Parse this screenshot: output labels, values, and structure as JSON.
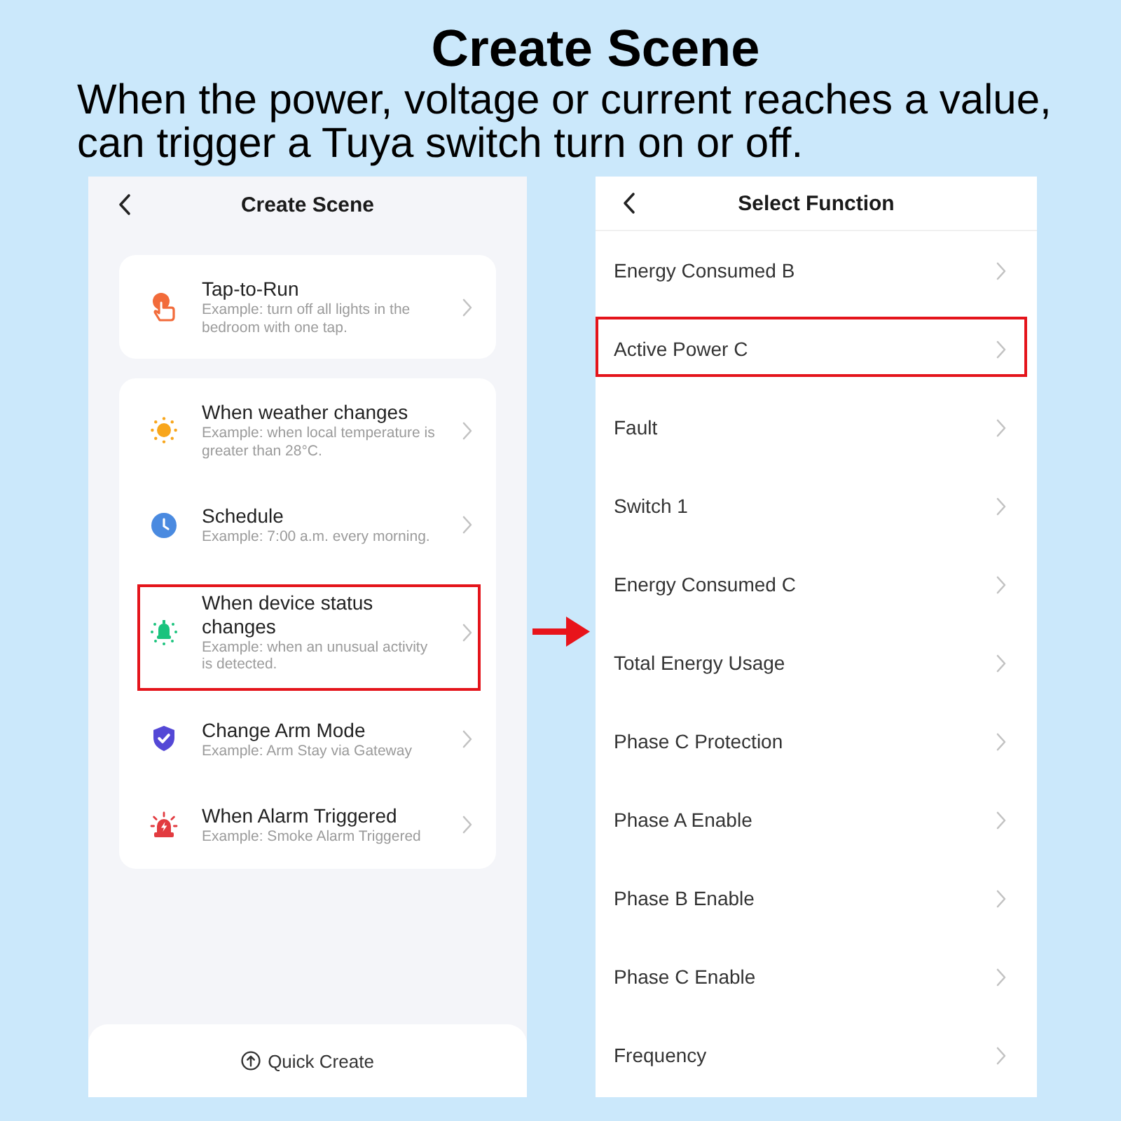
{
  "header": {
    "title": "Create Scene",
    "description": "When the power, voltage or current reaches a value, can trigger a Tuya switch turn on or off."
  },
  "scene_screen": {
    "title": "Create Scene",
    "groups": [
      {
        "items": [
          {
            "kind": "tap",
            "title": "Tap-to-Run",
            "example": "Example: turn off all lights in the bedroom with one tap.",
            "highlighted": false
          }
        ]
      },
      {
        "items": [
          {
            "kind": "weather",
            "title": "When weather changes",
            "example": "Example: when local temperature is greater than 28°C.",
            "highlighted": false
          },
          {
            "kind": "schedule",
            "title": "Schedule",
            "example": "Example: 7:00 a.m. every morning.",
            "highlighted": false
          },
          {
            "kind": "device",
            "title": "When device status changes",
            "example": "Example: when an unusual activity is detected.",
            "highlighted": true
          },
          {
            "kind": "arm_mode",
            "title": "Change Arm Mode",
            "example": "Example: Arm Stay via Gateway",
            "highlighted": false
          },
          {
            "kind": "alarm",
            "title": "When Alarm Triggered",
            "example": "Example: Smoke Alarm Triggered",
            "highlighted": false
          }
        ]
      }
    ],
    "quick_create": {
      "label": "Quick Create"
    }
  },
  "function_screen": {
    "title": "Select Function",
    "items": [
      {
        "label": "Energy Consumed B",
        "highlighted": false
      },
      {
        "label": "Active Power C",
        "highlighted": true
      },
      {
        "label": "Fault",
        "highlighted": false
      },
      {
        "label": "Switch 1",
        "highlighted": false
      },
      {
        "label": "Energy Consumed C",
        "highlighted": false
      },
      {
        "label": "Total Energy Usage",
        "highlighted": false
      },
      {
        "label": "Phase C Protection",
        "highlighted": false
      },
      {
        "label": "Phase A Enable",
        "highlighted": false
      },
      {
        "label": "Phase B Enable",
        "highlighted": false
      },
      {
        "label": "Phase C Enable",
        "highlighted": false
      },
      {
        "label": "Frequency",
        "highlighted": false
      }
    ]
  }
}
